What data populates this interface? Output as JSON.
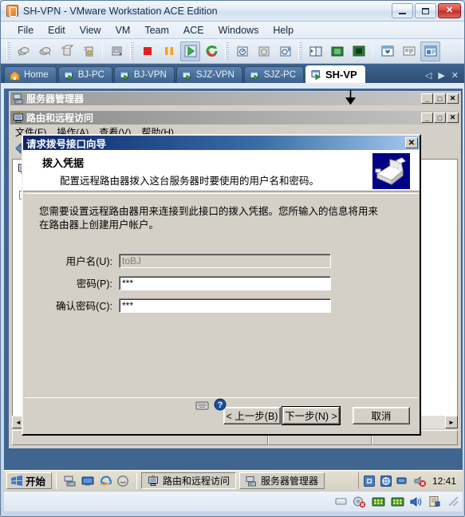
{
  "window": {
    "title": "SH-VPN - VMware Workstation ACE Edition",
    "icon": "vmware-icon",
    "buttons": {
      "minimize": "Minimize",
      "maximize": "Maximize",
      "close": "Close"
    }
  },
  "menubar": {
    "items": [
      "File",
      "Edit",
      "View",
      "VM",
      "Team",
      "ACE",
      "Windows",
      "Help"
    ]
  },
  "toolbar": {
    "groups": [
      {
        "buttons": [
          {
            "name": "power-on-snapshot-icon",
            "title": "Take Snapshot"
          },
          {
            "name": "revert-snapshot-icon",
            "title": "Revert Snapshot"
          },
          {
            "name": "snapshot-manager-icon",
            "title": "Snapshot Manager"
          },
          {
            "name": "capture-movie-icon",
            "title": "Capture Movie"
          }
        ]
      },
      {
        "buttons": [
          {
            "name": "clone-vm-icon",
            "title": "Clone Virtual Machine"
          }
        ]
      },
      {
        "buttons": [
          {
            "name": "power-off-icon",
            "title": "Power Off"
          },
          {
            "name": "suspend-icon",
            "title": "Suspend"
          },
          {
            "name": "power-on-icon",
            "title": "Power On"
          },
          {
            "name": "reset-icon",
            "title": "Reset"
          }
        ]
      },
      {
        "buttons": [
          {
            "name": "snapshot-take-icon",
            "title": "Snapshot"
          },
          {
            "name": "snapshot-revert-icon",
            "title": "Revert"
          },
          {
            "name": "snapshot-manage-icon",
            "title": "Manage Snapshots"
          }
        ]
      },
      {
        "buttons": [
          {
            "name": "show-sidebar-icon",
            "title": "Sidebar"
          },
          {
            "name": "quick-switch-icon",
            "title": "Quick Switch"
          },
          {
            "name": "fullscreen-icon",
            "title": "Full Screen"
          }
        ]
      },
      {
        "buttons": [
          {
            "name": "vm-settings-icon",
            "title": "Virtual Machine Settings"
          },
          {
            "name": "summary-view-icon",
            "title": "Summary"
          },
          {
            "name": "console-view-icon",
            "title": "Console View",
            "pressed": true
          }
        ]
      }
    ]
  },
  "tabs": {
    "items": [
      {
        "label": "Home",
        "icon": "home-icon",
        "active": false
      },
      {
        "label": "BJ-PC",
        "icon": "vm-icon",
        "active": false
      },
      {
        "label": "BJ-VPN",
        "icon": "vm-icon",
        "active": false
      },
      {
        "label": "SJZ-VPN",
        "icon": "vm-icon",
        "active": false
      },
      {
        "label": "SJZ-PC",
        "icon": "vm-icon",
        "active": false
      },
      {
        "label": "SH-VP",
        "icon": "vm-icon",
        "active": true
      }
    ],
    "nav": {
      "prev": "◁",
      "next": "▶",
      "close": "✕"
    }
  },
  "guest": {
    "server_manager": {
      "title": "服务器管理器",
      "icon": "server-manager-icon",
      "buttons": {
        "minimize": "_",
        "maximize": "□",
        "close": "✕"
      }
    },
    "routing_remote_access": {
      "title": "路由和远程访问",
      "icon": "rras-icon",
      "buttons": {
        "minimize": "_",
        "maximize": "□",
        "close": "✕"
      },
      "menu": [
        "文件(F)",
        "操作(A)",
        "查看(V)",
        "帮助(H)"
      ],
      "status_cells": [
        "",
        "",
        ""
      ]
    }
  },
  "wizard": {
    "title": "请求拨号接口向导",
    "close_label": "✕",
    "header_title": "拨入凭据",
    "header_subtitle": "配置远程路由器拨入这台服务器时要使用的用户名和密码。",
    "banner_icon": "dialup-credentials-icon",
    "description_line1": "您需要设置远程路由器用来连接到此接口的拨入凭据。您所输入的信息将用来",
    "description_line2": "在路由器上创建用户帐户。",
    "fields": [
      {
        "label": "用户名(U):",
        "value": "toBJ",
        "disabled": true,
        "name": "username-field"
      },
      {
        "label": "密码(P):",
        "value": "***",
        "disabled": false,
        "name": "password-field"
      },
      {
        "label": "确认密码(C):",
        "value": "***",
        "disabled": false,
        "name": "confirm-password-field"
      }
    ],
    "buttons": {
      "back": "< 上一步(B)",
      "next": "下一步(N) >",
      "cancel": "取消"
    }
  },
  "taskbar": {
    "start_label": "开始",
    "quick_launch": [
      {
        "name": "server-manager-quick-icon"
      },
      {
        "name": "show-desktop-icon"
      },
      {
        "name": "internet-explorer-icon"
      },
      {
        "name": "ie-alt-icon"
      }
    ],
    "tasks": [
      {
        "label": "路由和远程访问",
        "icon": "rras-icon",
        "active": true
      },
      {
        "label": "服务器管理器",
        "icon": "server-manager-icon",
        "active": false
      }
    ],
    "tray": [
      {
        "name": "network-config-tray-icon"
      },
      {
        "name": "security-tray-icon"
      },
      {
        "name": "network-tray-icon"
      },
      {
        "name": "volume-muted-tray-icon"
      }
    ],
    "clock": "12:41"
  },
  "vm_status": {
    "icons": [
      {
        "name": "floppy-status-icon"
      },
      {
        "name": "harddisk-status-icon"
      },
      {
        "name": "network1-status-icon"
      },
      {
        "name": "network2-status-icon"
      },
      {
        "name": "sound-status-icon"
      },
      {
        "name": "printer-status-icon"
      }
    ]
  },
  "colors": {
    "accent": "#3f6590",
    "dialog_face": "#d4d0c8",
    "title_gradient_start": "#0a246a",
    "close_button": "#d9453c"
  }
}
